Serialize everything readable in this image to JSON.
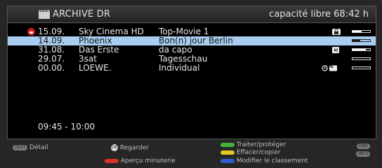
{
  "header": {
    "title": "ARCHIVE DR",
    "free_space": "capacité libre 68:42 h"
  },
  "recordings": [
    {
      "date": "15.09.",
      "channel": "Sky Cinema HD",
      "title": "Movie 1",
      "title_prefix": "Top-",
      "locked": true,
      "selected": false,
      "status": "lock-badge-icon",
      "progress": 0.5
    },
    {
      "date": "14.09.",
      "channel": "Phoenix",
      "title": "Bon(n) jour Berlin",
      "locked": false,
      "selected": true,
      "status": "",
      "progress": 0.45
    },
    {
      "date": "31.08.",
      "channel": "Das Erste",
      "title": "da capo",
      "locked": false,
      "selected": false,
      "status": "play-partial-icon",
      "progress": 0.75
    },
    {
      "date": "29.07.",
      "channel": "3sat",
      "title": "Tagesschau",
      "locked": false,
      "selected": false,
      "status": "",
      "progress": 0
    },
    {
      "date": "00.00.",
      "channel": "LOEWE.",
      "title": "Individual",
      "locked": false,
      "selected": false,
      "status": "timer-recording-icons",
      "progress": 0
    }
  ],
  "time_range": "09:45 - 10:00",
  "legend": {
    "text_key": "TEXT",
    "detail": "Détail",
    "ok_key": "OK",
    "watch": "Regarder",
    "red_action": "Aperçu minuterie",
    "green_action": "Traiter/protéger",
    "yellow_action": "Effacer/copier",
    "blue_action": "Modifier le classement",
    "end_key": "END",
    "info_key": "INFO"
  },
  "colors": {
    "red": "#d9302a",
    "green": "#3fb23a",
    "yellow": "#e3c81e",
    "blue": "#2f5fcf",
    "selection": "#a9cdf0"
  }
}
